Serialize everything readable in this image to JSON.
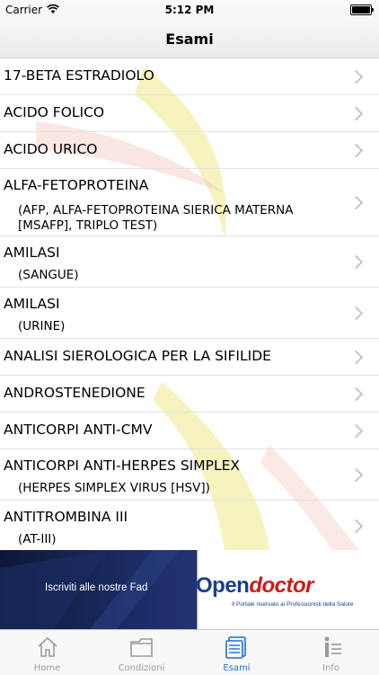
{
  "status": {
    "carrier": "Carrier",
    "time": "5:12 PM"
  },
  "nav": {
    "title": "Esami"
  },
  "list": [
    {
      "title": "17-BETA ESTRADIOLO",
      "sub": ""
    },
    {
      "title": "ACIDO FOLICO",
      "sub": ""
    },
    {
      "title": "ACIDO URICO",
      "sub": ""
    },
    {
      "title": "ALFA-FETOPROTEINA",
      "sub": "(AFP, ALFA-FETOPROTEINA SIERICA MATERNA [MSAFP], TRIPLO TEST)"
    },
    {
      "title": "AMILASI",
      "sub": "(SANGUE)"
    },
    {
      "title": "AMILASI",
      "sub": "(URINE)"
    },
    {
      "title": "ANALISI SIEROLOGICA PER LA SIFILIDE",
      "sub": ""
    },
    {
      "title": "ANDROSTENEDIONE",
      "sub": ""
    },
    {
      "title": "ANTICORPI ANTI-CMV",
      "sub": ""
    },
    {
      "title": "ANTICORPI ANTI-HERPES SIMPLEX",
      "sub": "(HERPES SIMPLEX VIRUS [HSV])"
    },
    {
      "title": "ANTITROMBINA III",
      "sub": "(AT-III)"
    }
  ],
  "banner": {
    "cta": "Iscriviti alle nostre Fad",
    "logo_open": "Open",
    "logo_doctor": "doctor",
    "logo_tagline": "Il Portale riservato ai Professionisti della Salute"
  },
  "tabs": [
    {
      "label": "Home",
      "icon": "home-icon",
      "active": false
    },
    {
      "label": "Condizioni",
      "icon": "folder-icon",
      "active": false
    },
    {
      "label": "Esami",
      "icon": "documents-icon",
      "active": true
    },
    {
      "label": "Info",
      "icon": "info-icon",
      "active": false
    }
  ],
  "colors": {
    "accent": "#1f6fd6",
    "logo_blue": "#1b3d8f",
    "logo_red": "#d11919"
  }
}
